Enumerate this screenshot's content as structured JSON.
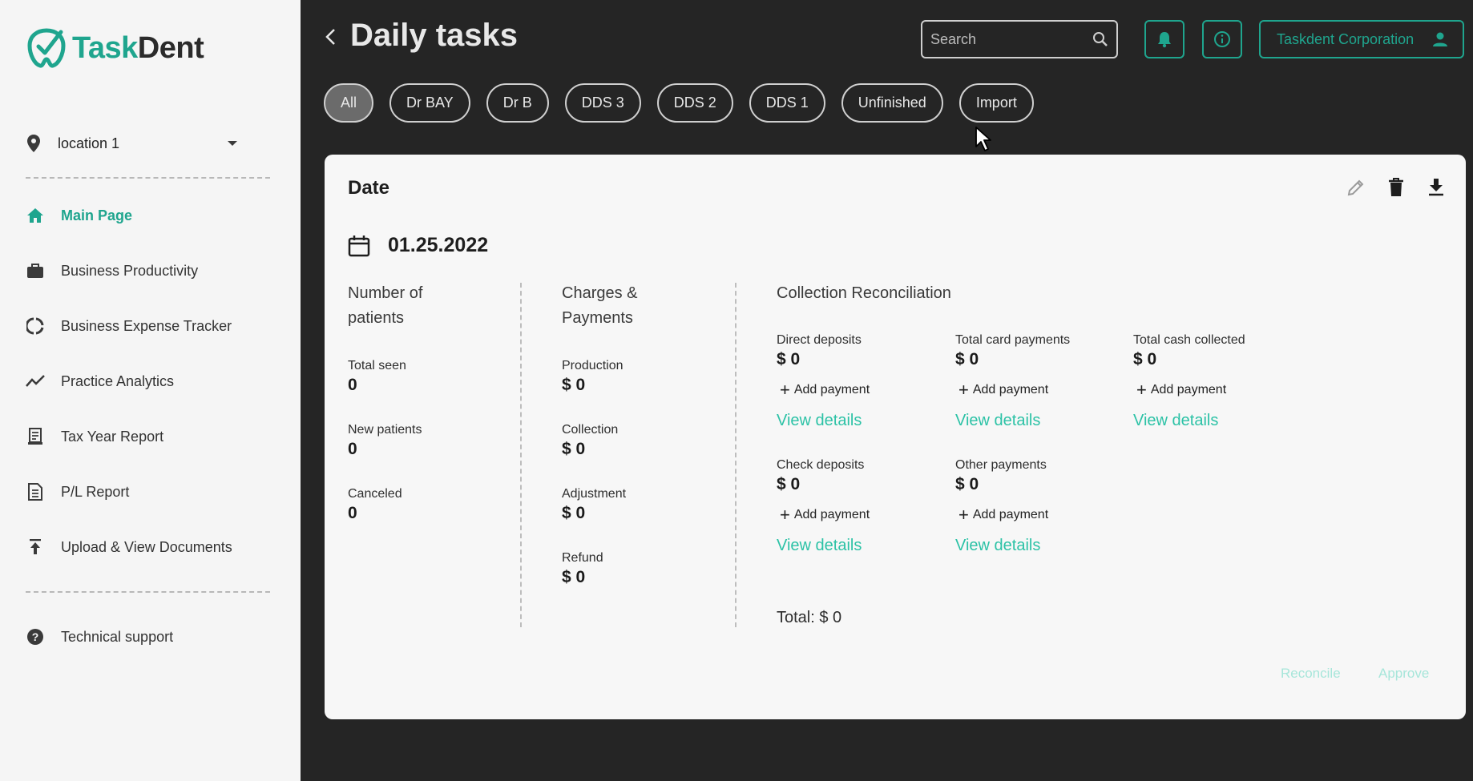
{
  "app": {
    "logo_prefix": "Task",
    "logo_suffix": "Dent",
    "brand_color": "#1fa58e",
    "link_color": "#2cc2a6"
  },
  "sidebar": {
    "location": "location 1",
    "items": [
      {
        "label": "Main Page",
        "icon": "home-icon",
        "active": true
      },
      {
        "label": "Business Productivity",
        "icon": "briefcase-icon"
      },
      {
        "label": "Business Expense Tracker",
        "icon": "donut-chart-icon"
      },
      {
        "label": "Practice Analytics",
        "icon": "trend-line-icon"
      },
      {
        "label": "Tax Year Report",
        "icon": "receipt-icon"
      },
      {
        "label": "P/L Report",
        "icon": "document-icon"
      },
      {
        "label": "Upload & View Documents",
        "icon": "upload-icon"
      }
    ],
    "support": {
      "label": "Technical support",
      "icon": "help-circle-icon"
    }
  },
  "header": {
    "title": "Daily tasks",
    "search_placeholder": "Search",
    "account_label": "Taskdent Corporation"
  },
  "filters": [
    "All",
    "Dr BAY",
    "Dr B",
    "DDS 3",
    "DDS 2",
    "DDS 1",
    "Unfinished",
    "Import"
  ],
  "card": {
    "title": "Date",
    "date": "01.25.2022",
    "patients": {
      "title_line1": "Number of",
      "title_line2": "patients",
      "total_seen_label": "Total seen",
      "total_seen_value": "0",
      "new_patients_label": "New patients",
      "new_patients_value": "0",
      "canceled_label": "Canceled",
      "canceled_value": "0"
    },
    "charges": {
      "title_line1": "Charges &",
      "title_line2": "Payments",
      "production_label": "Production",
      "production_value": "$ 0",
      "collection_label": "Collection",
      "collection_value": "$ 0",
      "adjustment_label": "Adjustment",
      "adjustment_value": "$ 0",
      "refund_label": "Refund",
      "refund_value": "$ 0"
    },
    "reconciliation": {
      "title": "Collection Reconciliation",
      "add_payment": "Add payment",
      "view_details": "View details",
      "direct_label": "Direct deposits",
      "direct_value": "$ 0",
      "card_label": "Total card payments",
      "card_value": "$ 0",
      "cash_label": "Total cash collected",
      "cash_value": "$ 0",
      "check_label": "Check deposits",
      "check_value": "$ 0",
      "other_label": "Other payments",
      "other_value": "$ 0",
      "total": "Total: $ 0"
    },
    "reconcile_label": "Reconcile",
    "approve_label": "Approve"
  }
}
